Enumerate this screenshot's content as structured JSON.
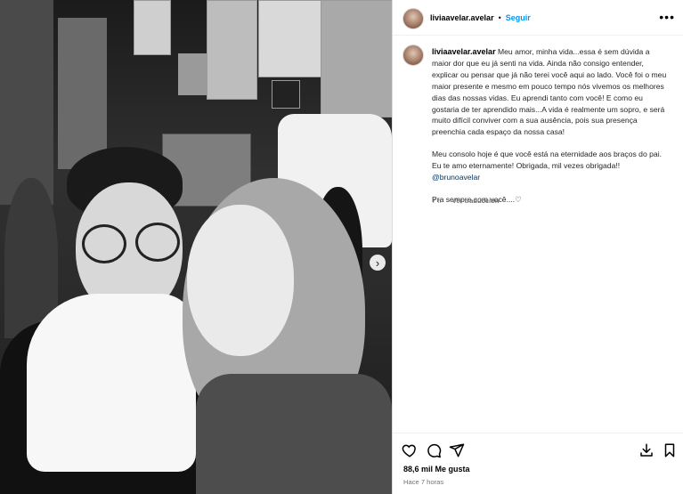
{
  "post": {
    "username": "liviaavelar.avelar",
    "separator": "•",
    "follow_label": "Seguir",
    "more_label": "•••",
    "caption": {
      "username": "liviaavelar.avelar",
      "paragraph1": "Meu amor, minha vida...essa é sem dúvida a maior dor que eu já senti na vida. Ainda não consigo entender, explicar ou pensar que já não terei você aqui ao lado. Você foi o meu maior presente e mesmo em pouco tempo nós vivemos os melhores dias das nossas vidas. Eu aprendi tanto com você! E como eu gostaria de ter aprendido mais...A vida é realmente um sopro, e será muito difícil conviver com a sua ausência, pois sua presença preenchia cada espaço da nossa casa!",
      "paragraph2": "Meu consolo hoje é que você está na eternidade aos braços do pai. Eu te amo eternamente! Obrigada, mil vezes obrigada!!",
      "mention": "@brunoavelar",
      "paragraph3": "Pra sempre com você....♡"
    },
    "meta": {
      "age": "7 h",
      "translate_label": "Ver traducción"
    },
    "likes_label": "88,6 mil Me gusta",
    "timestamp": "Hace 7 horas"
  },
  "icons": {
    "like": "heart-icon",
    "comment": "comment-icon",
    "share": "paper-plane-icon",
    "save": "bookmark-icon",
    "download": "download-icon",
    "next": "chevron-right-icon"
  }
}
